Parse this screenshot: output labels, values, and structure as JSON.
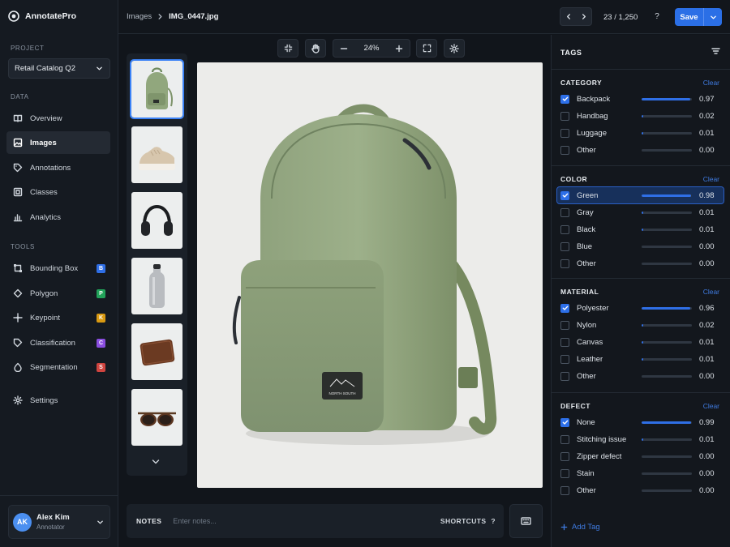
{
  "app": {
    "name": "AnnotatePro"
  },
  "sidebar": {
    "project_label": "PROJECT",
    "project_value": "Retail Catalog Q2",
    "data_label": "DATA",
    "data_items": [
      {
        "label": "Overview",
        "icon": "book-icon"
      },
      {
        "label": "Images",
        "icon": "image-icon",
        "active": true
      },
      {
        "label": "Annotations",
        "icon": "tag-icon"
      },
      {
        "label": "Classes",
        "icon": "box-icon"
      },
      {
        "label": "Analytics",
        "icon": "bar-chart-icon"
      }
    ],
    "tools_label": "TOOLS",
    "tools": [
      {
        "label": "Bounding Box",
        "badge": "B",
        "color": "#2f6fe6"
      },
      {
        "label": "Polygon",
        "badge": "P",
        "color": "#22a35a"
      },
      {
        "label": "Keypoint",
        "badge": "K",
        "color": "#d99a12"
      },
      {
        "label": "Classification",
        "badge": "C",
        "color": "#8a4ee0"
      },
      {
        "label": "Segmentation",
        "badge": "S",
        "color": "#d0443f"
      }
    ],
    "settings_label": "Settings",
    "user": {
      "initials": "AK",
      "name": "Alex Kim",
      "role": "Annotator"
    }
  },
  "topbar": {
    "breadcrumb_root": "Images",
    "breadcrumb_current": "IMG_0447.jpg",
    "counter": "23 / 1,250",
    "help": "?",
    "save_label": "Save"
  },
  "toolbar": {
    "zoom": "24%"
  },
  "thumbnails": [
    {
      "name": "backpack"
    },
    {
      "name": "sneaker"
    },
    {
      "name": "headphones"
    },
    {
      "name": "water-bottle"
    },
    {
      "name": "wallet"
    },
    {
      "name": "sunglasses"
    }
  ],
  "image": {
    "patch_text": "NORTH SOUTH"
  },
  "notes": {
    "label": "NOTES",
    "placeholder": "Enter notes...",
    "shortcuts_label": "SHORTCUTS",
    "shortcuts_help": "?"
  },
  "tags": {
    "title": "TAGS",
    "clear_label": "Clear",
    "add_label": "Add Tag",
    "groups": [
      {
        "title": "CATEGORY",
        "items": [
          {
            "label": "Backpack",
            "checked": true,
            "score": "0.97"
          },
          {
            "label": "Handbag",
            "checked": false,
            "score": "0.02"
          },
          {
            "label": "Luggage",
            "checked": false,
            "score": "0.01"
          },
          {
            "label": "Other",
            "checked": false,
            "score": "0.00"
          }
        ]
      },
      {
        "title": "COLOR",
        "items": [
          {
            "label": "Green",
            "checked": true,
            "score": "0.98",
            "highlight": true
          },
          {
            "label": "Gray",
            "checked": false,
            "score": "0.01"
          },
          {
            "label": "Black",
            "checked": false,
            "score": "0.01"
          },
          {
            "label": "Blue",
            "checked": false,
            "score": "0.00"
          },
          {
            "label": "Other",
            "checked": false,
            "score": "0.00"
          }
        ]
      },
      {
        "title": "MATERIAL",
        "items": [
          {
            "label": "Polyester",
            "checked": true,
            "score": "0.96"
          },
          {
            "label": "Nylon",
            "checked": false,
            "score": "0.02"
          },
          {
            "label": "Canvas",
            "checked": false,
            "score": "0.01"
          },
          {
            "label": "Leather",
            "checked": false,
            "score": "0.01"
          },
          {
            "label": "Other",
            "checked": false,
            "score": "0.00"
          }
        ]
      },
      {
        "title": "DEFECT",
        "items": [
          {
            "label": "None",
            "checked": true,
            "score": "0.99"
          },
          {
            "label": "Stitching issue",
            "checked": false,
            "score": "0.01"
          },
          {
            "label": "Zipper defect",
            "checked": false,
            "score": "0.00"
          },
          {
            "label": "Stain",
            "checked": false,
            "score": "0.00"
          },
          {
            "label": "Other",
            "checked": false,
            "score": "0.00"
          }
        ]
      }
    ]
  }
}
